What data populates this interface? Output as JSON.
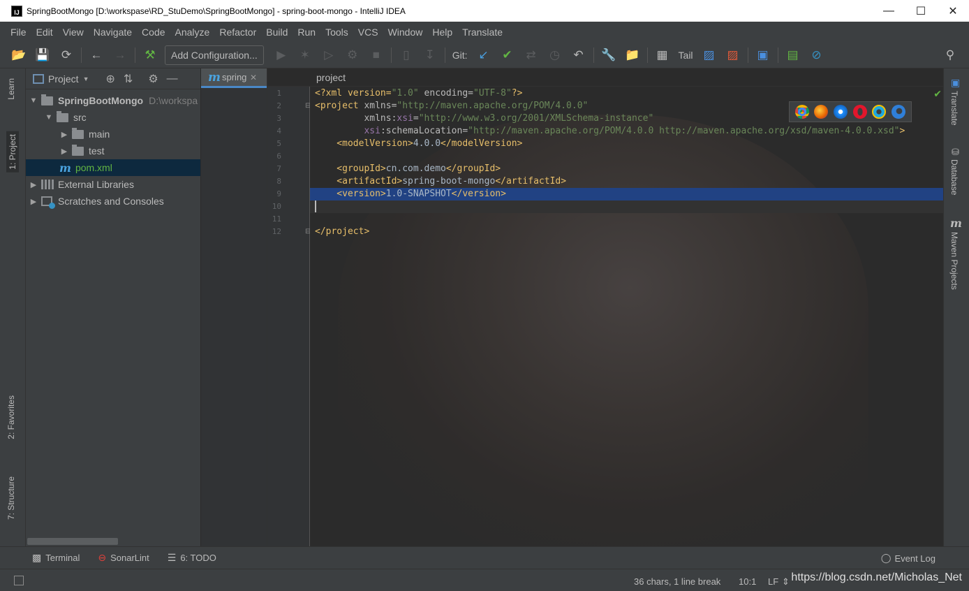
{
  "window": {
    "title": "SpringBootMongo [D:\\workspase\\RD_StuDemo\\SpringBootMongo] - spring-boot-mongo - IntelliJ IDEA",
    "app_icon_text": "IJ",
    "minimize": "—",
    "maximize": "☐",
    "close": "✕"
  },
  "menu": [
    "File",
    "Edit",
    "View",
    "Navigate",
    "Code",
    "Analyze",
    "Refactor",
    "Build",
    "Run",
    "Tools",
    "VCS",
    "Window",
    "Help",
    "Translate"
  ],
  "toolbar": {
    "add_configuration": "Add Configuration...",
    "git_label": "Git:",
    "tail_label": "Tail"
  },
  "left_stripe": {
    "learn": "Learn",
    "project": "1: Project",
    "favorites": "2: Favorites",
    "structure": "7: Structure"
  },
  "right_stripe": {
    "translate": "Translate",
    "database": "Database",
    "maven": "Maven Projects"
  },
  "project_panel": {
    "header": "Project",
    "tree": {
      "root_name": "SpringBootMongo",
      "root_path": "D:\\workspa",
      "src": "src",
      "main": "main",
      "test": "test",
      "pom": "pom.xml",
      "libs": "External Libraries",
      "scratches": "Scratches and Consoles"
    }
  },
  "editor": {
    "tab_label": "spring",
    "breadcrumb": "project",
    "line_numbers": [
      "1",
      "2",
      "3",
      "4",
      "5",
      "6",
      "7",
      "8",
      "9",
      "10",
      "11",
      "12"
    ],
    "code": {
      "l1_a": "<?xml version=",
      "l1_b": "\"1.0\"",
      "l1_c": " encoding=",
      "l1_d": "\"UTF-8\"",
      "l1_e": "?>",
      "l2_a": "<project ",
      "l2_b": "xmlns=",
      "l2_c": "\"http://maven.apache.org/POM/4.0.0\"",
      "l3_a": "         xmlns:",
      "l3_b": "xsi",
      "l3_c": "=",
      "l3_d": "\"http://www.w3.org/2001/XMLSchema-instance\"",
      "l4_a": "         ",
      "l4_b": "xsi",
      "l4_c": ":schemaLocation=",
      "l4_d": "\"http://maven.apache.org/POM/4.0.0 http://maven.apache.org/xsd/maven-4.0.0.xsd\"",
      "l4_e": ">",
      "l5_a": "    <modelVersion>",
      "l5_b": "4.0.0",
      "l5_c": "</modelVersion>",
      "l7_a": "    <groupId>",
      "l7_b": "cn.com.demo",
      "l7_c": "</groupId>",
      "l8_a": "    <artifactId>",
      "l8_b": "spring-boot-mongo",
      "l8_c": "</artifactId>",
      "l9_a": "    <version>",
      "l9_b": "1.0-SNAPSHOT",
      "l9_c": "</version>",
      "l12_a": "</project>"
    }
  },
  "bottom_tools": {
    "terminal": "Terminal",
    "sonarlint": "SonarLint",
    "todo": "6: TODO",
    "event_log": "Event Log"
  },
  "status": {
    "chars": "36 chars, 1 line break",
    "position": "10:1",
    "line_sep": "LF",
    "watermark": "https://blog.csdn.net/Micholas_Net"
  },
  "colors": {
    "accent": "#4a88c7",
    "selection": "#214283",
    "ok": "#62b543"
  }
}
